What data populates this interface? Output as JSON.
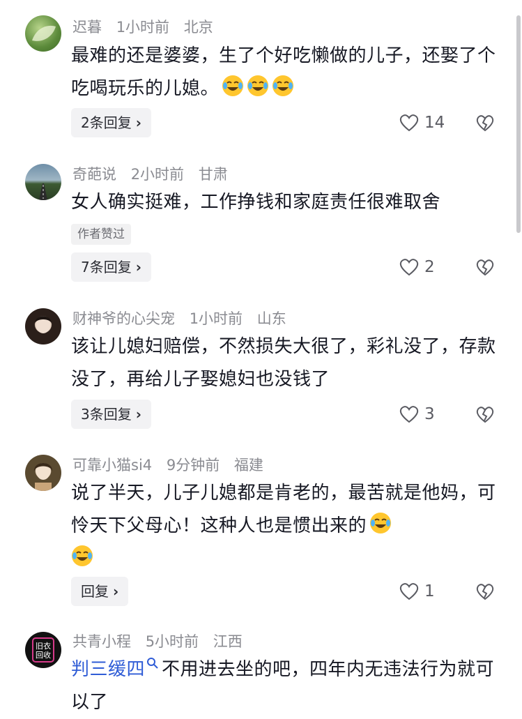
{
  "comments": [
    {
      "user": "迟暮",
      "time": "1小时前",
      "location": "北京",
      "text": "最难的还是婆婆，生了个好吃懒做的儿子，还娶了个吃喝玩乐的儿媳。",
      "emoji_count": 3,
      "reply_label": "2条回复",
      "likes": "14",
      "avatar_colors": [
        "#5b8a3a",
        "#9ec06a"
      ]
    },
    {
      "user": "奇葩说",
      "time": "2小时前",
      "location": "甘肃",
      "text": "女人确实挺难，工作挣钱和家庭责任很难取舍",
      "author_badge": "作者赞过",
      "reply_label": "7条回复",
      "likes": "2",
      "avatar_colors": [
        "#4a6b8a",
        "#2f4a2a"
      ]
    },
    {
      "user": "财神爷的心尖宠",
      "time": "1小时前",
      "location": "山东",
      "text": "该让儿媳妇赔偿，不然损失大很了，彩礼没了，存款没了，再给儿子娶媳妇也没钱了",
      "reply_label": "3条回复",
      "likes": "3",
      "avatar_colors": [
        "#3a2a22",
        "#d9c6b8"
      ]
    },
    {
      "user": "可靠小猫si4",
      "time": "9分钟前",
      "location": "福建",
      "text": "说了半天，儿子儿媳都是肯老的，最苦就是他妈，可怜天下父母心！这种人也是惯出来的",
      "emoji_count": 2,
      "reply_label": "回复",
      "likes": "1",
      "avatar_colors": [
        "#6b5a3a",
        "#e8d6c0"
      ]
    },
    {
      "user": "共青小程",
      "time": "5小时前",
      "location": "江西",
      "mention": "判三缓四",
      "text": "不用进去坐的吧，四年内无违法行为就可以了",
      "avatar_text_line1": "旧衣",
      "avatar_text_line2": "回收",
      "avatar_colors": [
        "#111111",
        "#d63a8a"
      ]
    }
  ],
  "icons": {
    "like": "heart-outline-icon",
    "dislike": "broken-heart-icon",
    "emoji": "laughing-crying-emoji-icon",
    "search": "search-icon"
  }
}
